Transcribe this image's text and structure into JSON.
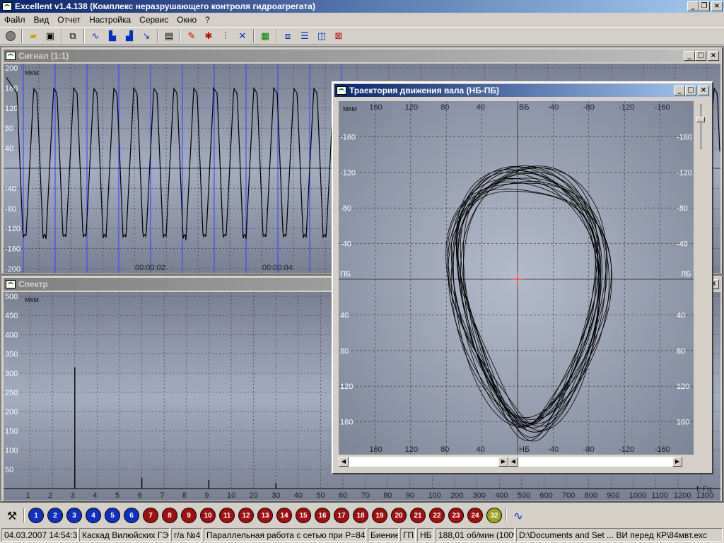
{
  "app": {
    "title": "Excellent v1.4.138 (Комплекс неразрушающего контроля гидроагрегата)"
  },
  "menu": [
    "Файл",
    "Вид",
    "Отчет",
    "Настройка",
    "Сервис",
    "Окно",
    "?"
  ],
  "windows": {
    "signal": {
      "title": "Сигнал (1:1)"
    },
    "spectrum": {
      "title": "Спектр"
    },
    "orbit": {
      "title": "Траектория движения вала (НБ-ПБ)"
    }
  },
  "chart_data": [
    {
      "type": "line",
      "title": "Сигнал (1:1)",
      "ylabel": "мкм",
      "y_ticks": [
        200,
        160,
        120,
        80,
        40,
        -40,
        -80,
        -120,
        -160,
        -200
      ],
      "x_tick_labels": [
        "00:00:02",
        "00:00:04"
      ],
      "ylim": [
        -200,
        200
      ],
      "peak_count": 21,
      "amplitude_max": 160,
      "amplitude_min": -145
    },
    {
      "type": "bar",
      "title": "Спектр",
      "ylabel": "мкм",
      "xlabel": "f, Гц",
      "y_ticks": [
        500,
        450,
        400,
        350,
        300,
        250,
        200,
        150,
        100,
        50
      ],
      "x_tick_labels": [
        "1",
        "2",
        "3",
        "4",
        "5",
        "6",
        "7",
        "8",
        "9",
        "10",
        "20",
        "30",
        "40",
        "50",
        "60",
        "70",
        "80",
        "90",
        "100",
        "200",
        "300",
        "400",
        "500",
        "600",
        "700",
        "800",
        "900",
        "1000",
        "1100",
        "1200",
        "1300"
      ],
      "ylim": [
        0,
        500
      ],
      "peaks": [
        {
          "f": 3,
          "amp": 315
        },
        {
          "f": 6,
          "amp": 28
        },
        {
          "f": 9,
          "amp": 22
        },
        {
          "f": 12,
          "amp": 15
        }
      ]
    },
    {
      "type": "scatter",
      "title": "Траектория движения вала (НБ-ПБ)",
      "unit": "мкм",
      "x_ticks": [
        160,
        120,
        80,
        40,
        -40,
        -80,
        -120,
        -160
      ],
      "y_ticks": [
        -160,
        -120,
        -80,
        -40,
        40,
        80,
        120,
        160
      ],
      "axis_labels": {
        "top": "ВБ",
        "bottom": "НБ",
        "left": "ПБ",
        "right": "ЛБ"
      },
      "xlim": [
        200,
        -200
      ],
      "ylim": [
        -200,
        200
      ],
      "orbit_center": [
        -12,
        25
      ],
      "orbit_radius_x": [
        60,
        75
      ],
      "orbit_radius_y": [
        150,
        165
      ]
    }
  ],
  "channels": [
    {
      "n": "1",
      "color": "#1030c0"
    },
    {
      "n": "2",
      "color": "#1030c0"
    },
    {
      "n": "3",
      "color": "#1030c0"
    },
    {
      "n": "4",
      "color": "#1030c0"
    },
    {
      "n": "5",
      "color": "#1030c0"
    },
    {
      "n": "6",
      "color": "#1030c0"
    },
    {
      "n": "7",
      "color": "#a01010"
    },
    {
      "n": "8",
      "color": "#a01010"
    },
    {
      "n": "9",
      "color": "#a01010"
    },
    {
      "n": "10",
      "color": "#a01010"
    },
    {
      "n": "11",
      "color": "#a01010"
    },
    {
      "n": "12",
      "color": "#a01010"
    },
    {
      "n": "13",
      "color": "#a01010"
    },
    {
      "n": "14",
      "color": "#a01010"
    },
    {
      "n": "15",
      "color": "#a01010"
    },
    {
      "n": "16",
      "color": "#a01010"
    },
    {
      "n": "17",
      "color": "#a01010"
    },
    {
      "n": "18",
      "color": "#a01010"
    },
    {
      "n": "19",
      "color": "#a01010"
    },
    {
      "n": "20",
      "color": "#a01010"
    },
    {
      "n": "21",
      "color": "#a01010"
    },
    {
      "n": "22",
      "color": "#a01010"
    },
    {
      "n": "23",
      "color": "#a01010"
    },
    {
      "n": "24",
      "color": "#a01010"
    },
    {
      "n": "32",
      "color": "#a0a020"
    }
  ],
  "status": [
    "04.03.2007 14:54:30",
    "Каскад Вилюйских ГЭС",
    "г/а №4",
    "Параллельная работа с сетью при P=84МВт",
    "Биение",
    "ГП",
    "НБ",
    "188,01 об/мин (100%)",
    "D:\\Documents and Set ... ВИ перед КР\\84мвт.exc"
  ],
  "colors": {
    "titlebar": "#0a246a",
    "plot_bg": "#8f97aa",
    "grid_blue": "#3040ff",
    "crosshair": "#ff2020"
  }
}
